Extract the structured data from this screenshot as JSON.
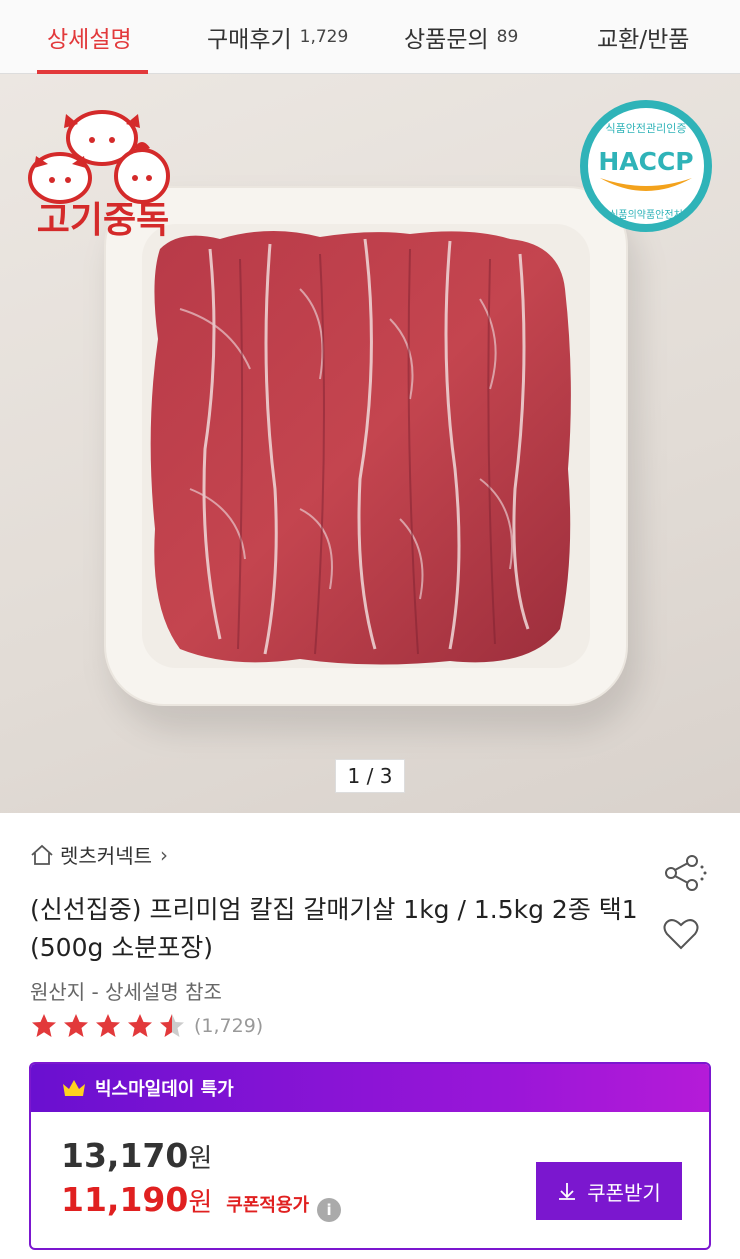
{
  "tabs": [
    {
      "label": "상세설명",
      "count": ""
    },
    {
      "label": "구매후기",
      "count": "1,729"
    },
    {
      "label": "상품문의",
      "count": "89"
    },
    {
      "label": "교환/반품",
      "count": ""
    }
  ],
  "hero": {
    "logo_text": "고기중독",
    "haccp": {
      "top": "식품안전관리인증",
      "mark": "HACCP",
      "bottom": "식품의약품안전처"
    },
    "counter": "1 / 3"
  },
  "product": {
    "seller": "렛츠커넥트",
    "title": "(신선집중) 프리미엄 칼집 갈매기살 1kg / 1.5kg 2종 택1 (500g 소분포장)",
    "origin": "원산지 - 상세설명 참조",
    "rating_value": 4.5,
    "rating_count": "(1,729)"
  },
  "promo": {
    "label": "빅스마일데이 특가",
    "price_original": "13,170",
    "price_sale": "11,190",
    "currency": "원",
    "coupon_note": "쿠폰적용가",
    "coupon_button": "쿠폰받기",
    "accent_color": "#7b17cf",
    "sale_color": "#e02020"
  },
  "icons": [
    "home-icon",
    "chevron-right-icon",
    "share-icon",
    "heart-icon",
    "star-icon",
    "crown-icon",
    "info-icon",
    "download-icon"
  ]
}
